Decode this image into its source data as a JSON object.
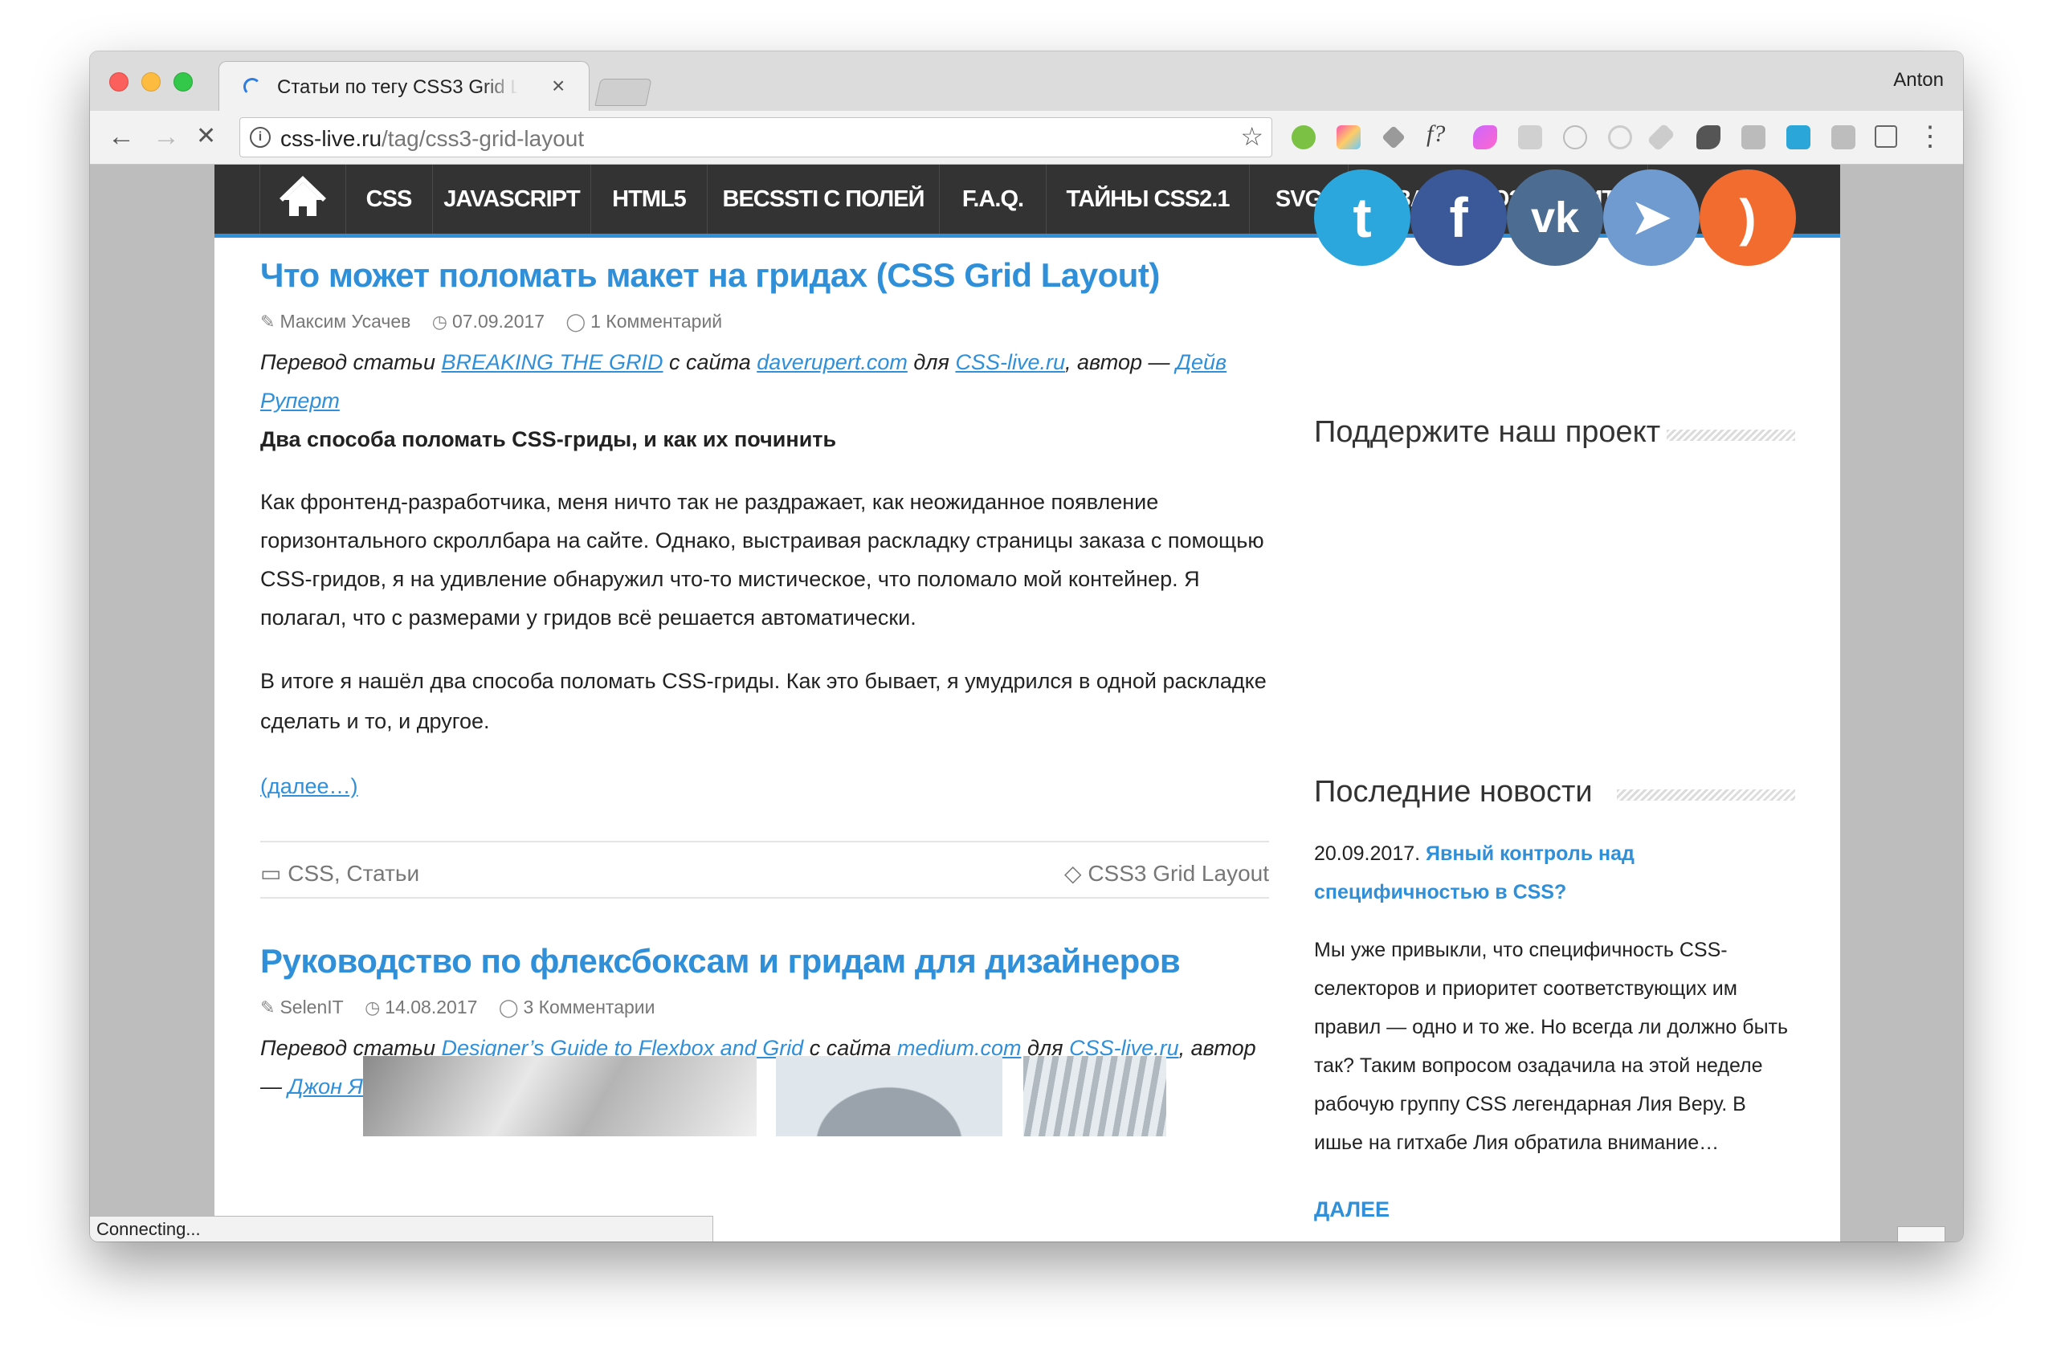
{
  "window": {
    "tab_title": "Статьи по тегу CSS3 Grid Layout",
    "tab_close": "×",
    "profile_name": "Anton"
  },
  "toolbar": {
    "url_domain": "css-live.ru",
    "url_path": "/tag/css3-grid-layout",
    "info_glyph": "i",
    "back_glyph": "←",
    "forward_glyph": "→",
    "stop_glyph": "✕",
    "bookmark_glyph": "☆",
    "extension_text": "f?",
    "menu_glyph": "⋮",
    "extensions": [
      "evernote-icon",
      "colorzilla-icon",
      "dropbox-icon",
      "fonts-ninja-icon",
      "paint-icon",
      "screenshot-icon",
      "react-devtools-icon",
      "target-icon",
      "tools-icon",
      "s-icon",
      "id-icon",
      "skype-icon",
      "image-icon",
      "thumbs-up-icon"
    ]
  },
  "nav": {
    "home_icon": "home-icon",
    "items": [
      "CSS",
      "JAVASCRIPT",
      "HTML5",
      "ВЕСЅЅТІ С ПОЛЕЙ",
      "F.A.Q.",
      "ТАЙНЫ CSS2.1",
      "SVG",
      "ДИЗАЙН И ЮЗАБИЛИТИ"
    ]
  },
  "posts": [
    {
      "title": "Что может поломать макет на гридах (CSS Grid Layout)",
      "author": "Максим Усачев",
      "date": "07.09.2017",
      "comments": "1 Комментарий",
      "intro_prefix": "Перевод статьи ",
      "intro_link1": "BREAKING THE GRID",
      "intro_mid1": " с сайта ",
      "intro_link2": "daverupert.com",
      "intro_mid2": " для ",
      "intro_link3": "CSS-live.ru",
      "intro_mid3": ", автор — ",
      "intro_link4": "Дейв Руперт",
      "subheading": "Два способа поломать CSS-гриды, и как их починить",
      "para1": "Как фронтенд-разработчика, меня ничто так не раздражает, как неожиданное появление горизонтального скроллбара на сайте. Однако, выстраивая раскладку страницы заказа с помощью CSS-гридов, я на удивление обнаружил что-то мистическое, что поломало мой контейнер. Я полагал, что с размерами у гридов всё решается автоматически.",
      "para2": "В итоге я нашёл два способа поломать CSS-гриды. Как это бывает, я умудрился в одной раскладке сделать и то, и другое.",
      "more": "(далее…)",
      "cat1": "CSS",
      "cat_sep": ", ",
      "cat2": "Статьи",
      "tag": "CSS3 Grid Layout"
    },
    {
      "title": "Руководство по флексбоксам и гридам для дизайнеров",
      "author": "SelenIT",
      "date": "14.08.2017",
      "comments": "3 Комментарии",
      "intro_prefix": "Перевод статьи ",
      "intro_link1": "Designer’s Guide to Flexbox and Grid",
      "intro_mid1": " с сайта ",
      "intro_link2": "medium.com",
      "intro_mid2": " для ",
      "intro_link3": "CSS-live.ru",
      "intro_mid3": ", автор — ",
      "intro_link4": "Джон Яблонски"
    }
  ],
  "sidebar": {
    "social": [
      {
        "name": "twitter",
        "glyph": "t",
        "color": "#2ba7de"
      },
      {
        "name": "facebook",
        "glyph": "f",
        "color": "#3b5998"
      },
      {
        "name": "vk",
        "glyph": "vk",
        "color": "#4c6c91"
      },
      {
        "name": "telegram",
        "glyph": "➤",
        "color": "#6f9bd1"
      },
      {
        "name": "rss",
        "glyph": ")",
        "color": "#f26b2f"
      }
    ],
    "support_title": "Поддержите наш проект",
    "news_title": "Последние новости",
    "news_date": "20.09.2017. ",
    "news_link": "Явный контроль над специфичностью в CSS?",
    "news_text": "Мы уже привыкли, что специфичность CSS-селекторов и приоритет соответствующих им правил — одно и то же. Но всегда ли должно быть так? Таким вопросом озадачила на этой неделе рабочую группу CSS легендарная Лия Веру. В ишье на гитхабе Лия обратила внимание…",
    "more": "ДАЛЕЕ"
  },
  "status_text": "Connecting...",
  "scroll_top_glyph": "⌃"
}
